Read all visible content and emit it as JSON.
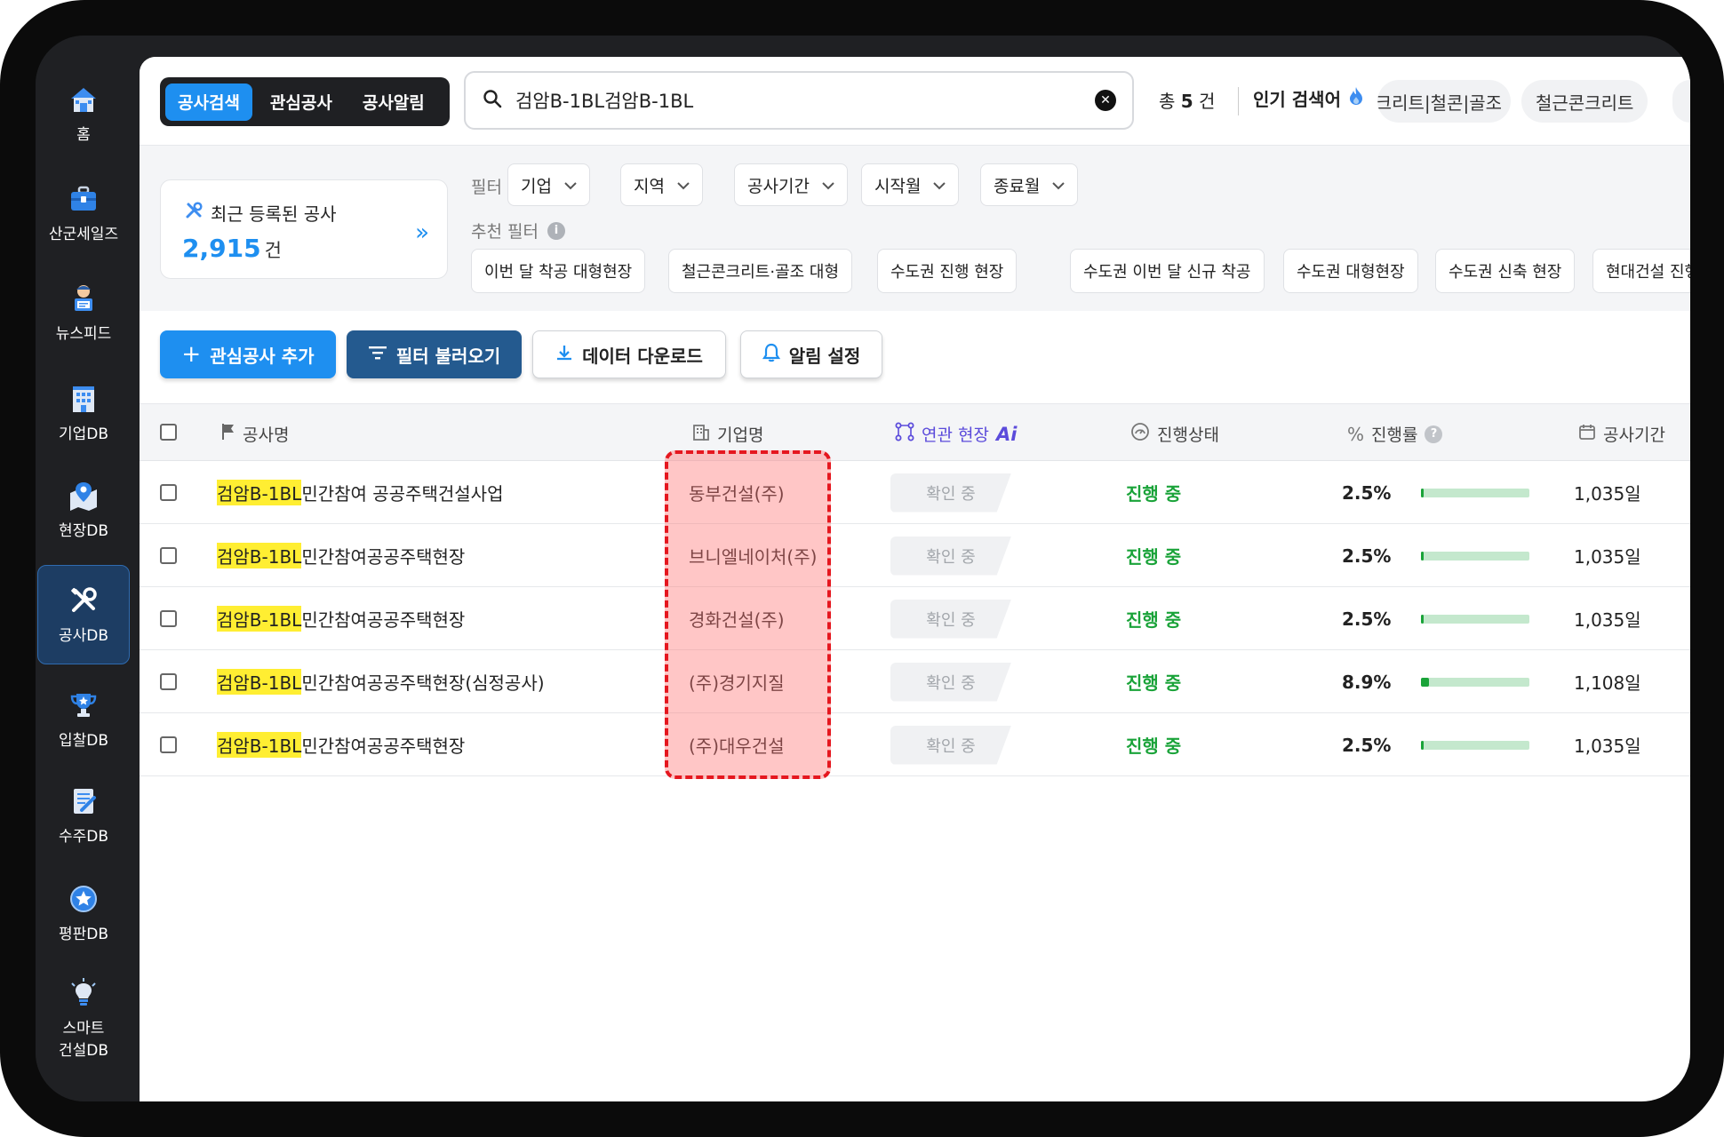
{
  "sidebar": {
    "items": [
      {
        "label": "홈",
        "icon": "home-icon"
      },
      {
        "label": "산군세일즈",
        "icon": "briefcase-icon"
      },
      {
        "label": "뉴스피드",
        "icon": "news-reader-icon"
      },
      {
        "label": "기업DB",
        "icon": "building-icon"
      },
      {
        "label": "현장DB",
        "icon": "map-pin-icon"
      },
      {
        "label": "공사DB",
        "icon": "tools-icon",
        "active": true
      },
      {
        "label": "입찰DB",
        "icon": "trophy-icon"
      },
      {
        "label": "수주DB",
        "icon": "contract-icon"
      },
      {
        "label": "평판DB",
        "icon": "star-badge-icon"
      },
      {
        "label": "스마트 건설DB",
        "line1": "스마트",
        "line2": "건설DB",
        "icon": "lightbulb-icon"
      }
    ]
  },
  "header": {
    "tabs": [
      {
        "label": "공사검색",
        "active": true
      },
      {
        "label": "관심공사"
      },
      {
        "label": "공사알림"
      }
    ],
    "search": {
      "value": "검암B-1BL검암B-1BL"
    },
    "total_prefix": "총",
    "total_count": "5",
    "total_suffix": "건",
    "popular_label": "인기 검색어",
    "popular_chips": [
      "크리트|철콘|골조",
      "철근콘크리트"
    ]
  },
  "filters": {
    "recent": {
      "title": "최근 등록된 공사",
      "count": "2,915",
      "unit": "건"
    },
    "filter_label": "필터",
    "dropdowns": [
      "기업",
      "지역",
      "공사기간",
      "시작월",
      "종료월"
    ],
    "recommend_label": "추천 필터",
    "recommended": [
      "이번 달 착공 대형현장",
      "철근콘크리트·골조 대형",
      "수도권 진행 현장",
      "수도권 이번 달 신규 착공",
      "수도권 대형현장",
      "수도권 신축 현장",
      "현대건설 진행현장"
    ]
  },
  "actions": {
    "add_interest": "관심공사 추가",
    "load_filter": "필터 불러오기",
    "download": "데이터 다운로드",
    "alert": "알림 설정"
  },
  "table": {
    "columns": {
      "name": "공사명",
      "company": "기업명",
      "related": "연관 현장",
      "ai": "Ai",
      "status": "진행상태",
      "progress": "진행률",
      "period": "공사기간"
    },
    "rows": [
      {
        "highlight": "검암B-1BL",
        "rest": "민간참여 공공주택건설사업",
        "company": "동부건설(주)",
        "related": "확인 중",
        "status": "진행 중",
        "progress": "2.5%",
        "progress_value": 2.5,
        "period": "1,035일"
      },
      {
        "highlight": "검암B-1BL",
        "rest": "민간참여공공주택현장",
        "company": "브니엘네이처(주)",
        "related": "확인 중",
        "status": "진행 중",
        "progress": "2.5%",
        "progress_value": 2.5,
        "period": "1,035일"
      },
      {
        "highlight": "검암B-1BL",
        "rest": "민간참여공공주택현장",
        "company": "경화건설(주)",
        "related": "확인 중",
        "status": "진행 중",
        "progress": "2.5%",
        "progress_value": 2.5,
        "period": "1,035일"
      },
      {
        "highlight": "검암B-1BL",
        "rest": "민간참여공공주택현장(심정공사)",
        "company": "(주)경기지질",
        "related": "확인 중",
        "status": "진행 중",
        "progress": "8.9%",
        "progress_value": 8.9,
        "period": "1,108일"
      },
      {
        "highlight": "검암B-1BL",
        "rest": "민간참여공공주택현장",
        "company": "(주)대우건설",
        "related": "확인 중",
        "status": "진행 중",
        "progress": "2.5%",
        "progress_value": 2.5,
        "period": "1,035일"
      }
    ]
  },
  "colors": {
    "accent": "#1e8ff0",
    "dark_button": "#245a8f",
    "status_green": "#1aa339",
    "highlight_yellow": "#ffee32",
    "annotation_red": "#e5171f"
  }
}
